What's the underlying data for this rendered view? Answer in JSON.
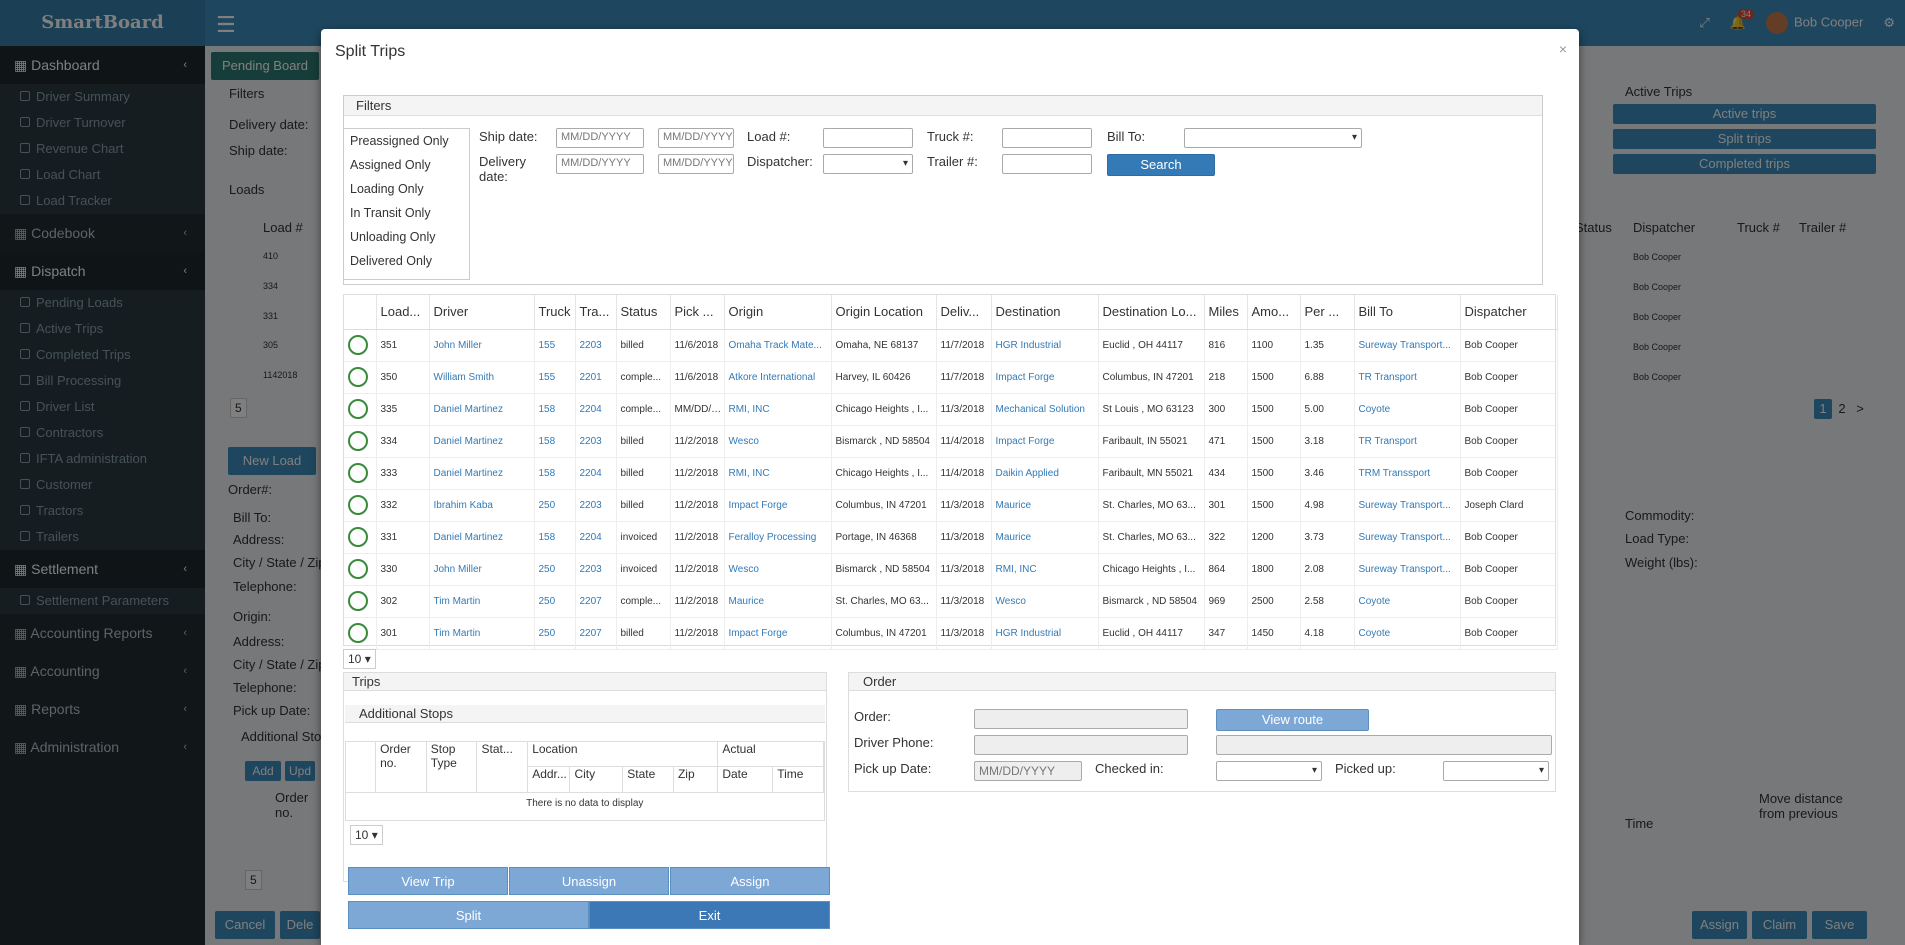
{
  "app": {
    "brand": "SmartBoard",
    "user_name": "Bob Cooper",
    "notification_count": "34"
  },
  "sidebar": {
    "items": [
      {
        "label": "Dashboard",
        "type": "head",
        "active": true
      },
      {
        "label": "Driver Summary",
        "type": "sub"
      },
      {
        "label": "Driver Turnover",
        "type": "sub"
      },
      {
        "label": "Revenue Chart",
        "type": "sub"
      },
      {
        "label": "Load Chart",
        "type": "sub"
      },
      {
        "label": "Load Tracker",
        "type": "sub"
      },
      {
        "label": "Codebook",
        "type": "head"
      },
      {
        "label": "Dispatch",
        "type": "head",
        "active": true
      },
      {
        "label": "Pending Loads",
        "type": "sub"
      },
      {
        "label": "Active Trips",
        "type": "sub"
      },
      {
        "label": "Completed Trips",
        "type": "sub"
      },
      {
        "label": "Bill Processing",
        "type": "sub"
      },
      {
        "label": "Driver List",
        "type": "sub"
      },
      {
        "label": "Contractors",
        "type": "sub"
      },
      {
        "label": "IFTA administration",
        "type": "sub"
      },
      {
        "label": "Customer",
        "type": "sub"
      },
      {
        "label": "Tractors",
        "type": "sub"
      },
      {
        "label": "Trailers",
        "type": "sub"
      },
      {
        "label": "Settlement",
        "type": "head",
        "active": true
      },
      {
        "label": "Settlement Parameters",
        "type": "sub"
      },
      {
        "label": "Accounting Reports",
        "type": "head"
      },
      {
        "label": "Accounting",
        "type": "head"
      },
      {
        "label": "Reports",
        "type": "head"
      },
      {
        "label": "Administration",
        "type": "head"
      }
    ]
  },
  "background": {
    "pending_board_tab": "Pending Board",
    "filters": "Filters",
    "delivery_date": "Delivery date:",
    "ship_date": "Ship date:",
    "loads": "Loads",
    "load_hash": "Load #",
    "load_ids": [
      "410",
      "334",
      "331",
      "305",
      "1142018"
    ],
    "new_load": "New Load",
    "order_hash": "Order#:",
    "bill_to": "Bill To:",
    "address": "Address:",
    "city_state_zip": "City / State / Zip",
    "telephone": "Telephone:",
    "origin": "Origin:",
    "address2": "Address:",
    "city_state2": "City / State / Zip",
    "telephone2": "Telephone:",
    "pickup_date": "Pick up Date:",
    "additional_stops": "Additional Stops",
    "add": "Add",
    "upd": "Upd",
    "order_no": "Order no.",
    "active_trips_title": "Active Trips",
    "active_trips_btn": "Active trips",
    "split_trips_btn": "Split trips",
    "completed_trips_btn": "Completed trips",
    "status_col": "Status",
    "dispatcher_col": "Dispatcher",
    "truck_col": "Truck #",
    "trailer_col": "Trailer #",
    "dispatcher_vals": [
      "Bob Cooper",
      "Bob Cooper",
      "Bob Cooper",
      "Bob Cooper",
      "Bob Cooper"
    ],
    "page1": "1",
    "page2": "2",
    "page_next": ">",
    "commodity": "Commodity:",
    "load_type": "Load Type:",
    "weight": "Weight (lbs):",
    "time": "Time",
    "move_distance": "Move distance from previous",
    "cancel": "Cancel",
    "dele": "Dele",
    "assign": "Assign",
    "claim": "Claim",
    "save": "Save",
    "pager5a": "5",
    "pager5b": "5"
  },
  "modal": {
    "title": "Split Trips",
    "close": "×",
    "filters": {
      "legend": "Filters",
      "status_options": [
        "Preassigned Only",
        "Assigned Only",
        "Loading Only",
        "In Transit Only",
        "Unloading Only",
        "Delivered Only"
      ],
      "ship_date_label": "Ship date:",
      "delivery_date_label": "Delivery date:",
      "date_placeholder_1": "MM/DD/YYYY",
      "date_placeholder_2": "MM/DD/YYYY",
      "date_placeholder_3": "MM/DD/YYYY",
      "date_placeholder_4": "MM/DD/YYYY",
      "load_label": "Load #:",
      "dispatcher_label": "Dispatcher:",
      "truck_label": "Truck #:",
      "trailer_label": "Trailer #:",
      "bill_to_label": "Bill To:",
      "search_button": "Search"
    },
    "grid": {
      "columns": [
        "Load...",
        "Driver",
        "Truck",
        "Tra...",
        "Status",
        "Pick ...",
        "Origin",
        "Origin Location",
        "Deliv...",
        "Destination",
        "Destination Lo...",
        "Miles",
        "Amo...",
        "Per ...",
        "Bill To",
        "Dispatcher"
      ],
      "rows": [
        [
          "351",
          "John Miller",
          "155",
          "2203",
          "billed",
          "11/6/2018",
          "Omaha Track Mate...",
          "Omaha, NE 68137",
          "11/7/2018",
          "HGR Industrial",
          "Euclid , OH 44117",
          "816",
          "1100",
          "1.35",
          "Sureway Transport...",
          "Bob Cooper"
        ],
        [
          "350",
          "William Smith",
          "155",
          "2201",
          "comple...",
          "11/6/2018",
          "Atkore International",
          "Harvey, IL 60426",
          "11/7/2018",
          "Impact Forge",
          "Columbus, IN 47201",
          "218",
          "1500",
          "6.88",
          "TR Transport",
          "Bob Cooper"
        ],
        [
          "335",
          "Daniel Martinez",
          "158",
          "2204",
          "comple...",
          "MM/DD/YY",
          "RMI, INC",
          "Chicago Heights , I...",
          "11/3/2018",
          "Mechanical Solution",
          "St Louis , MO 63123",
          "300",
          "1500",
          "5.00",
          "Coyote",
          "Bob Cooper"
        ],
        [
          "334",
          "Daniel Martinez",
          "158",
          "2203",
          "billed",
          "11/2/2018",
          "Wesco",
          "Bismarck , ND 58504",
          "11/4/2018",
          "Impact Forge",
          "Faribault, IN 55021",
          "471",
          "1500",
          "3.18",
          "TR Transport",
          "Bob Cooper"
        ],
        [
          "333",
          "Daniel Martinez",
          "158",
          "2204",
          "billed",
          "11/2/2018",
          "RMI, INC",
          "Chicago Heights , I...",
          "11/4/2018",
          "Daikin Applied",
          "Faribault, MN 55021",
          "434",
          "1500",
          "3.46",
          "TRM Transsport",
          "Bob Cooper"
        ],
        [
          "332",
          "Ibrahim Kaba",
          "250",
          "2203",
          "billed",
          "11/2/2018",
          "Impact Forge",
          "Columbus, IN 47201",
          "11/3/2018",
          "Maurice",
          "St. Charles, MO 63...",
          "301",
          "1500",
          "4.98",
          "Sureway Transport...",
          "Joseph Clard"
        ],
        [
          "331",
          "Daniel Martinez",
          "158",
          "2204",
          "invoiced",
          "11/2/2018",
          "Feralloy Processing",
          "Portage, IN 46368",
          "11/3/2018",
          "Maurice",
          "St. Charles, MO 63...",
          "322",
          "1200",
          "3.73",
          "Sureway Transport...",
          "Bob Cooper"
        ],
        [
          "330",
          "John Miller",
          "250",
          "2203",
          "invoiced",
          "11/2/2018",
          "Wesco",
          "Bismarck , ND 58504",
          "11/3/2018",
          "RMI, INC",
          "Chicago Heights , I...",
          "864",
          "1800",
          "2.08",
          "Sureway Transport...",
          "Bob Cooper"
        ],
        [
          "302",
          "Tim Martin",
          "250",
          "2207",
          "comple...",
          "11/2/2018",
          "Maurice",
          "St. Charles, MO 63...",
          "11/3/2018",
          "Wesco",
          "Bismarck , ND 58504",
          "969",
          "2500",
          "2.58",
          "Coyote",
          "Bob Cooper"
        ],
        [
          "301",
          "Tim Martin",
          "250",
          "2207",
          "billed",
          "11/2/2018",
          "Impact Forge",
          "Columbus, IN 47201",
          "11/3/2018",
          "HGR Industrial",
          "Euclid , OH 44117",
          "347",
          "1450",
          "4.18",
          "Coyote",
          "Bob Cooper"
        ]
      ],
      "page_size": "10"
    },
    "trips": {
      "title": "Trips",
      "additional_stops": "Additional Stops",
      "col_order_no": "Order no.",
      "col_stop_type": "Stop Type",
      "col_status": "Stat...",
      "col_location": "Location",
      "col_actual": "Actual",
      "col_addr": "Addr...",
      "col_city": "City",
      "col_state": "State",
      "col_zip": "Zip",
      "col_date": "Date",
      "col_time": "Time",
      "no_data": "There is no data to display",
      "page_size": "10",
      "view_trip": "View Trip",
      "unassign": "Unassign",
      "assign": "Assign",
      "split": "Split",
      "exit": "Exit"
    },
    "order": {
      "title": "Order",
      "order_label": "Order:",
      "driver_phone_label": "Driver Phone:",
      "pickup_date_label": "Pick up Date:",
      "pickup_date_placeholder": "MM/DD/YYYY",
      "checked_in_label": "Checked in:",
      "picked_up_label": "Picked up:",
      "view_route": "View route"
    }
  }
}
